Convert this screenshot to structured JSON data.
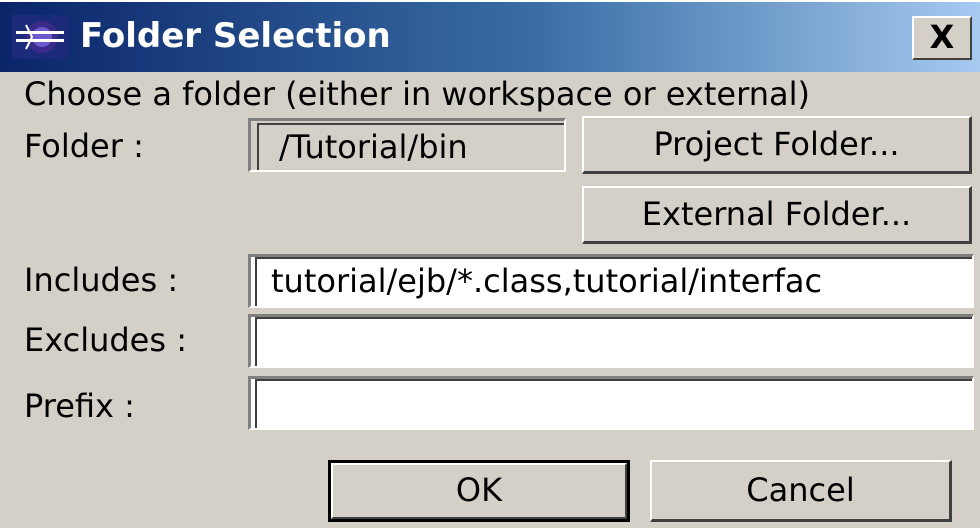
{
  "window": {
    "title": "Folder Selection",
    "icon": "eclipse-app-icon",
    "close_label": "X"
  },
  "instruction": "Choose a folder (either in workspace or external)",
  "folder": {
    "label": "Folder :",
    "value": "/Tutorial/bin"
  },
  "buttons": {
    "project_folder": "Project Folder...",
    "external_folder": "External Folder...",
    "ok": "OK",
    "cancel": "Cancel"
  },
  "includes": {
    "label": "Includes :",
    "value": "tutorial/ejb/*.class,tutorial/interfac"
  },
  "excludes": {
    "label": "Excludes :",
    "value": ""
  },
  "prefix": {
    "label": "Prefix :",
    "value": ""
  }
}
